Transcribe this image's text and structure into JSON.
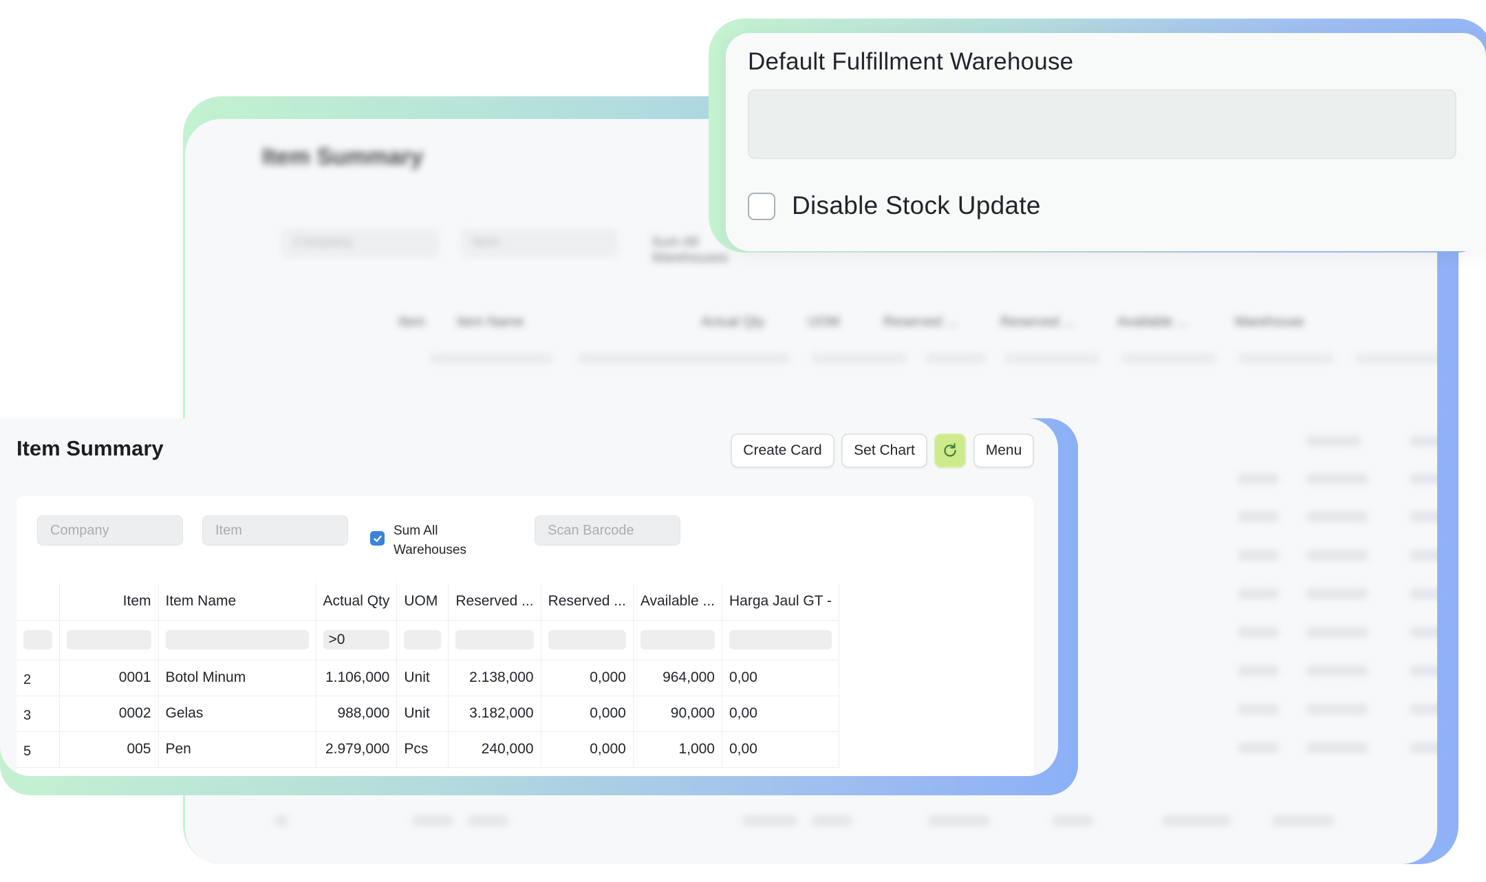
{
  "settings_card": {
    "warehouse_label": "Default Fulfillment Warehouse",
    "warehouse_value": "",
    "disable_stock_update_label": "Disable Stock Update",
    "disable_stock_update_checked": false
  },
  "report": {
    "title": "Item Summary",
    "buttons": {
      "create_card": "Create Card",
      "set_chart": "Set Chart",
      "refresh_icon": "refresh-icon",
      "menu": "Menu"
    },
    "filters": {
      "company_placeholder": "Company",
      "item_placeholder": "Item",
      "sum_all_label": "Sum All Warehouses",
      "sum_all_checked": true,
      "scan_barcode_placeholder": "Scan Barcode"
    },
    "columns": [
      "Item",
      "Item Name",
      "Actual Qty",
      "UOM",
      "Reserved ...",
      "Reserved ...",
      "Available ...",
      "Harga Jaul GT -"
    ],
    "column_filter_actual_qty": ">0",
    "rows": [
      {
        "idx": "2",
        "item": "0001",
        "item_name": "Botol Minum",
        "actual_qty": "1.106,000",
        "uom": "Unit",
        "reserved_1": "2.138,000",
        "reserved_2": "0,000",
        "available": "964,000",
        "harga": "0,00"
      },
      {
        "idx": "3",
        "item": "0002",
        "item_name": "Gelas",
        "actual_qty": "988,000",
        "uom": "Unit",
        "reserved_1": "3.182,000",
        "reserved_2": "0,000",
        "available": "90,000",
        "harga": "0,00"
      },
      {
        "idx": "5",
        "item": "005",
        "item_name": "Pen",
        "actual_qty": "2.979,000",
        "uom": "Pcs",
        "reserved_1": "240,000",
        "reserved_2": "0,000",
        "available": "1,000",
        "harga": "0,00"
      }
    ]
  },
  "background_report": {
    "title": "Item Summary",
    "filters": [
      "Company",
      "Item",
      "Sum All Warehouses"
    ],
    "columns": [
      "Item",
      "Item Name",
      "Actual Qty",
      "UOM",
      "Reserved ...",
      "Reserved ...",
      "Available ...",
      "Warehouse"
    ]
  }
}
